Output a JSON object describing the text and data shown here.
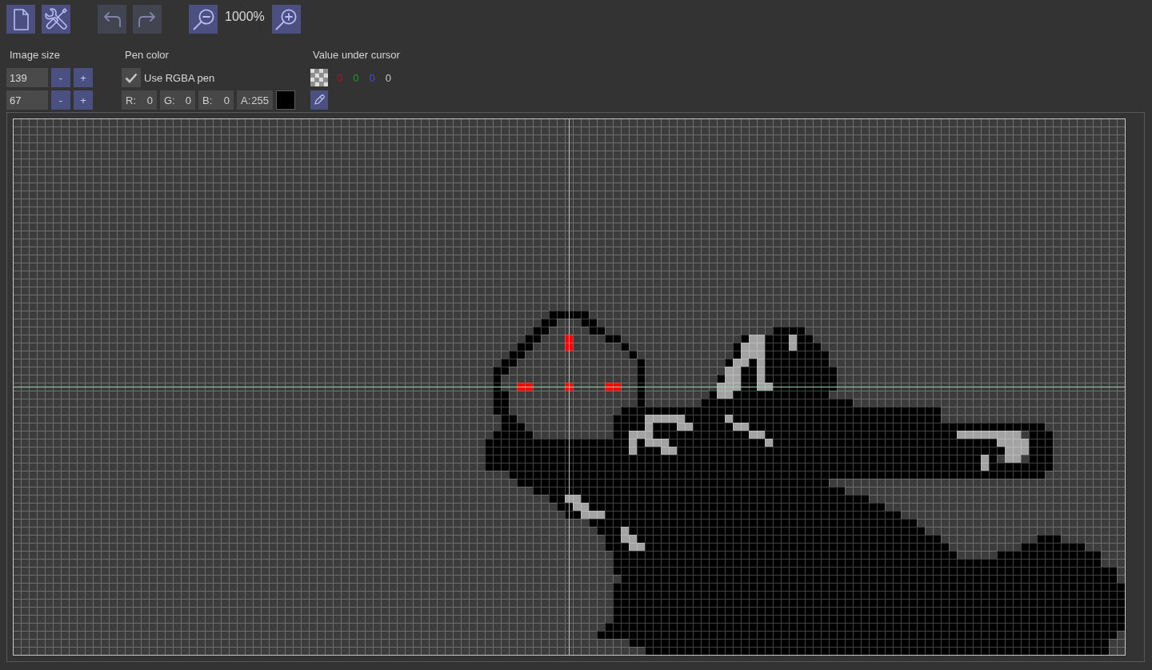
{
  "toolbar": [
    {
      "items": [
        {
          "kind": "new_file",
          "disabled": false
        },
        {
          "kind": "tools",
          "disabled": false
        }
      ]
    },
    {
      "items": [
        {
          "kind": "undo",
          "disabled": true
        },
        {
          "kind": "redo",
          "disabled": true
        }
      ]
    },
    {
      "items": [
        {
          "kind": "zoom_out",
          "disabled": false
        },
        {
          "kind": "readout",
          "text": "1000%"
        },
        {
          "kind": "zoom_in",
          "disabled": false
        }
      ]
    }
  ],
  "image_size": {
    "title": "Image size",
    "rows": [
      {
        "value": "139",
        "buttons": [
          "-",
          "+"
        ]
      },
      {
        "value": "67",
        "buttons": [
          "-",
          "+"
        ]
      }
    ]
  },
  "pen_color": {
    "title": "Pen color",
    "use_rgba": {
      "label": "Use RGBA pen",
      "checked": true
    },
    "channels": [
      {
        "label": "R:",
        "value": "0"
      },
      {
        "label": "G:",
        "value": "0"
      },
      {
        "label": "B:",
        "value": "0"
      },
      {
        "label": "A:",
        "value": "255"
      }
    ]
  },
  "cursor_value": {
    "title": "Value under cursor",
    "values": [
      {
        "text": "0",
        "color": "#a01c26"
      },
      {
        "text": "0",
        "color": "#1e9c1e"
      },
      {
        "text": "0",
        "color": "#4a4ae6"
      },
      {
        "text": "0",
        "color": "#c8c8c8"
      }
    ]
  }
}
